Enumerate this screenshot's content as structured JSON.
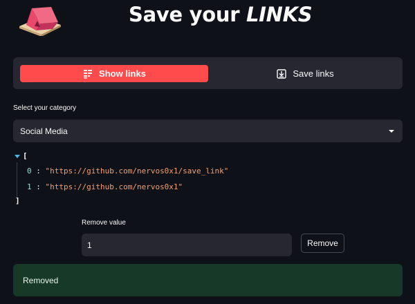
{
  "header": {
    "title_prefix": "Save your ",
    "title_emphasis": "LINKS"
  },
  "tabs": [
    {
      "label": "Show links",
      "active": true,
      "icon": "table-icon"
    },
    {
      "label": "Save links",
      "active": false,
      "icon": "download-icon"
    }
  ],
  "category": {
    "label": "Select your category",
    "selected": "Social Media"
  },
  "links_json": {
    "open": "[",
    "close": "]",
    "items": [
      {
        "index": "0",
        "value": "\"https://github.com/nervos0x1/save_link\""
      },
      {
        "index": "1",
        "value": "\"https://github.com/nervos0x1\""
      }
    ]
  },
  "remove": {
    "label": "Remove value",
    "value": "1",
    "button_label": "Remove"
  },
  "status": {
    "message": "Removed"
  },
  "colors": {
    "background": "#0e1117",
    "surface": "#262730",
    "accent": "#ff4b4b",
    "success_bg": "#173928",
    "json_string": "#f5a06c",
    "json_index": "#a3d9cc"
  }
}
